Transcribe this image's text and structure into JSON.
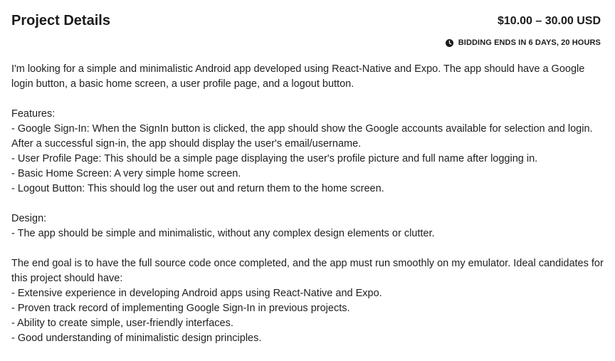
{
  "header": {
    "title": "Project Details",
    "price": "$10.00 – 30.00 USD",
    "bidding": "BIDDING ENDS IN 6 DAYS, 20 HOURS",
    "bidding_icon": "clock-icon"
  },
  "description": {
    "intro": "I'm looking for a simple and minimalistic Android app developed using React-Native and Expo. The app should have a Google login button, a basic home screen, a user profile page, and a logout button.",
    "features": {
      "heading": "Features:",
      "items": [
        "- Google Sign-In: When the SignIn button is clicked, the app should show the Google accounts available for selection and login. After a successful sign-in, the app should display the user's email/username.",
        "- User Profile Page: This should be a simple page displaying the user's profile picture and full name after logging in.",
        "- Basic Home Screen: A very simple home screen.",
        "- Logout Button: This should log the user out and return them to the home screen."
      ]
    },
    "design": {
      "heading": "Design:",
      "items": [
        "- The app should be simple and minimalistic, without any complex design elements or clutter."
      ]
    },
    "goal": {
      "text": "The end goal is to have the full source code once completed, and the app must run smoothly on my emulator. Ideal candidates for this project should have:",
      "items": [
        "- Extensive experience in developing Android apps using React-Native and Expo.",
        "- Proven track record of implementing Google Sign-In in previous projects.",
        "- Ability to create simple, user-friendly interfaces.",
        "- Good understanding of minimalistic design principles."
      ]
    }
  }
}
